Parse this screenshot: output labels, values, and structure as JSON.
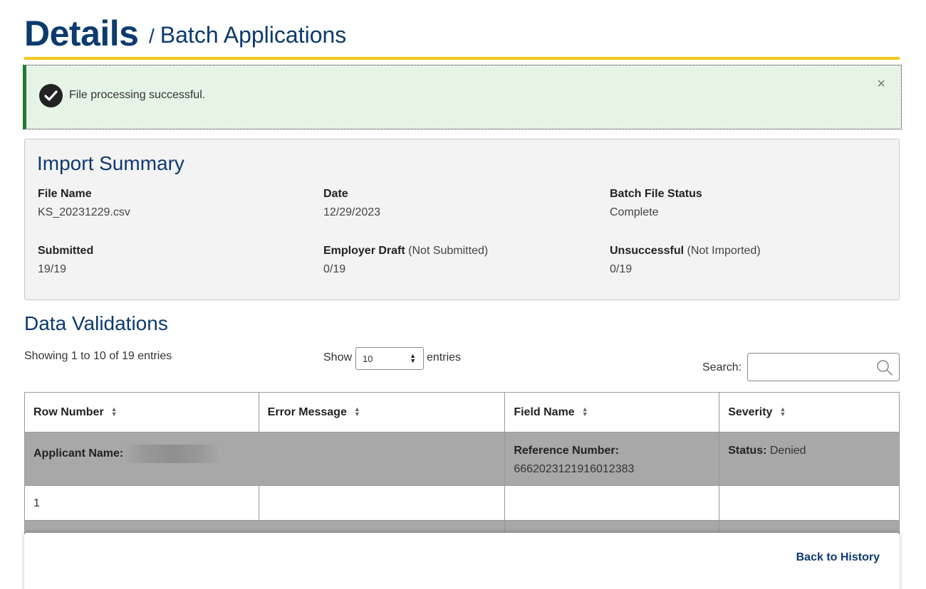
{
  "header": {
    "title": "Details",
    "separator": "/",
    "subtitle": "Batch Applications",
    "accent_color": "#f5c518",
    "title_color": "#0d3a6e"
  },
  "alert": {
    "icon": "check-circle-icon",
    "message": "File processing successful.",
    "close_label": "×",
    "color": "#1e7a34"
  },
  "summary": {
    "title": "Import Summary",
    "file_name": {
      "label": "File Name",
      "value": "KS_20231229.csv"
    },
    "date": {
      "label": "Date",
      "value": "12/29/2023"
    },
    "batch_status": {
      "label": "Batch File Status",
      "value": "Complete"
    },
    "submitted": {
      "label": "Submitted",
      "value": "19/19"
    },
    "employer_draft": {
      "label": "Employer Draft",
      "note": "(Not Submitted)",
      "value": "0/19"
    },
    "unsuccessful": {
      "label": "Unsuccessful",
      "note": "(Not Imported)",
      "value": "0/19"
    }
  },
  "validations": {
    "title": "Data Validations",
    "showing": "Showing 1 to 10 of 19 entries",
    "length": {
      "show_label": "Show",
      "selected": "10",
      "entries_label": "entries"
    },
    "search": {
      "label": "Search:",
      "value": "",
      "icon": "search-icon"
    },
    "columns": [
      "Row Number",
      "Error Message",
      "Field Name",
      "Severity"
    ],
    "group": {
      "applicant_label": "Applicant Name:",
      "reference_label": "Reference Number:",
      "reference_value": "6662023121916012383",
      "status_label": "Status:",
      "status_value": "Denied"
    },
    "rows": [
      {
        "row_number": "1",
        "error_message": "",
        "field_name": "",
        "severity": ""
      }
    ]
  },
  "footer": {
    "back_label": "Back to History"
  }
}
